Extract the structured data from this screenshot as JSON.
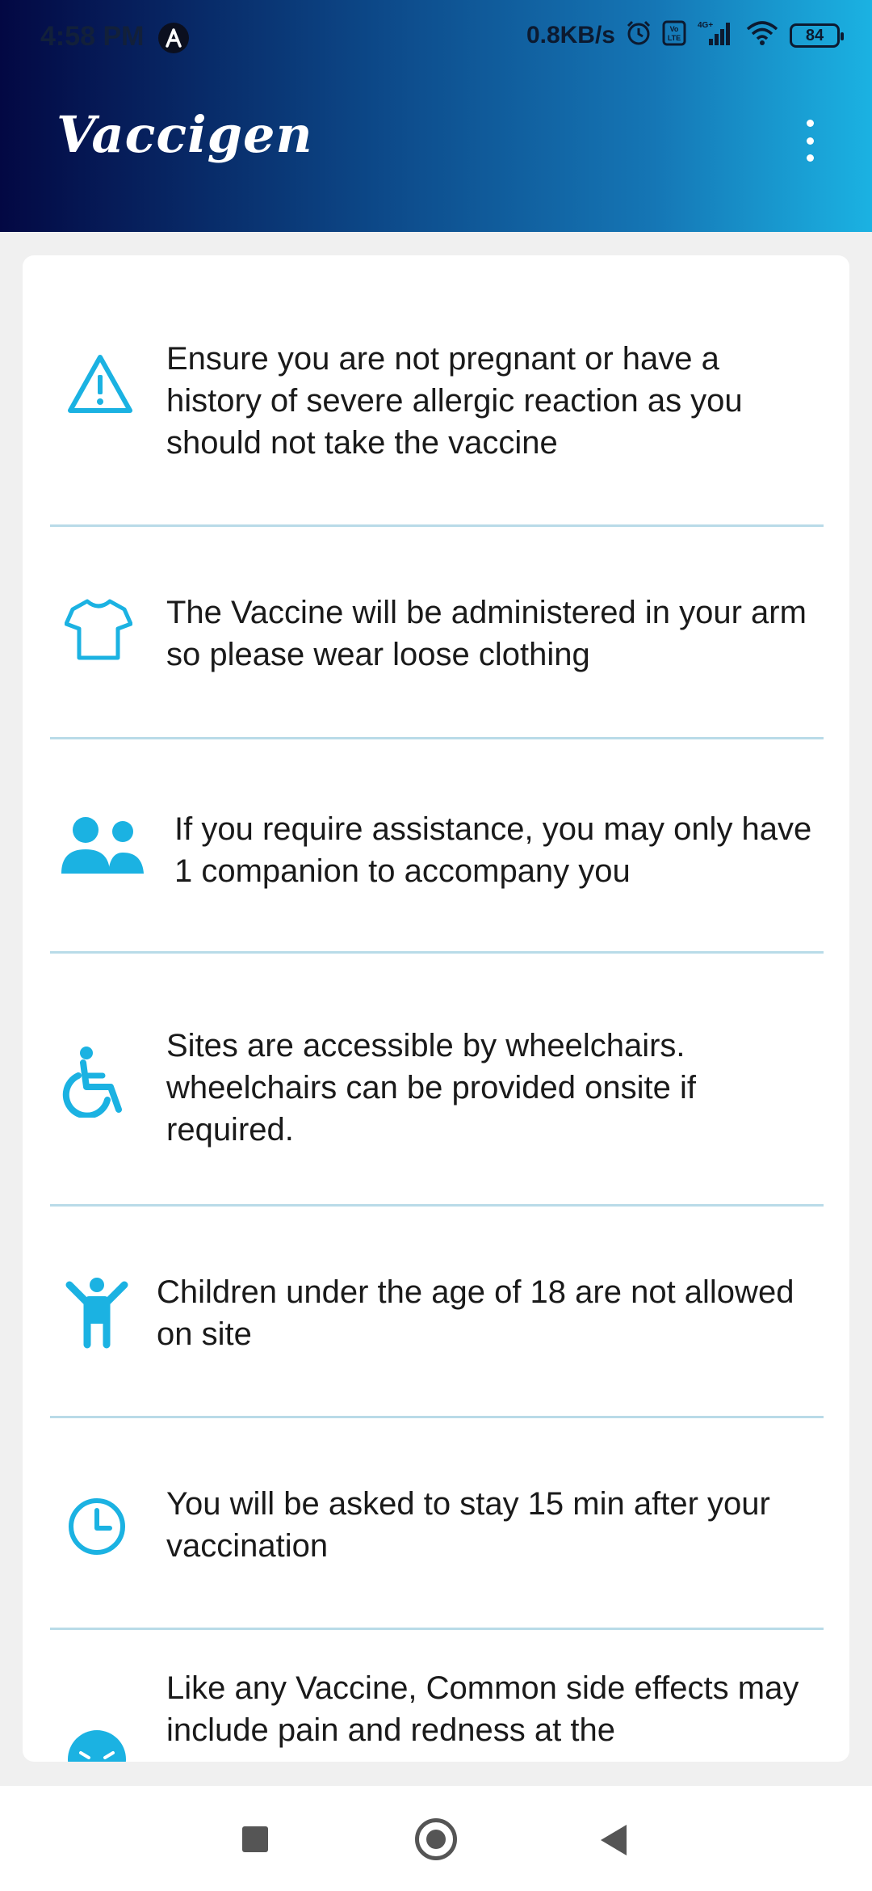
{
  "status_bar": {
    "time": "4:58 PM",
    "network_speed": "0.8KB/s",
    "battery": "84",
    "icons": [
      "a-notification-icon",
      "alarm-icon",
      "volte-icon",
      "4g-signal-icon",
      "wifi-icon",
      "battery-icon"
    ]
  },
  "app_bar": {
    "title": "Vaccigen",
    "menu_icon": "more-vert-icon"
  },
  "guidelines": [
    {
      "icon": "warning-icon",
      "text": "Ensure you are not pregnant or have a history of severe allergic reaction as you should not take the vaccine"
    },
    {
      "icon": "tshirt-icon",
      "text": "The Vaccine will be administered in your arm so please wear loose clothing"
    },
    {
      "icon": "people-icon",
      "text": "If you require assistance, you may only have 1 companion to accompany you"
    },
    {
      "icon": "wheelchair-icon",
      "text": "Sites are accessible by wheelchairs. wheelchairs can be provided onsite if required."
    },
    {
      "icon": "child-icon",
      "text": "Children under the age of 18 are not allowed on site"
    },
    {
      "icon": "clock-icon",
      "text": "You will be asked to stay 15 min after your vaccination"
    },
    {
      "icon": "sick-face-icon",
      "text": "Like any Vaccine, Common side effects may include pain and redness at the"
    }
  ],
  "colors": {
    "accent": "#1bb2e2",
    "header_start": "#030843",
    "header_end": "#1bb2e2",
    "divider": "#b9dbe8"
  },
  "nav_bar": {
    "icons": [
      "recents-square-icon",
      "home-circle-icon",
      "back-triangle-icon"
    ]
  }
}
